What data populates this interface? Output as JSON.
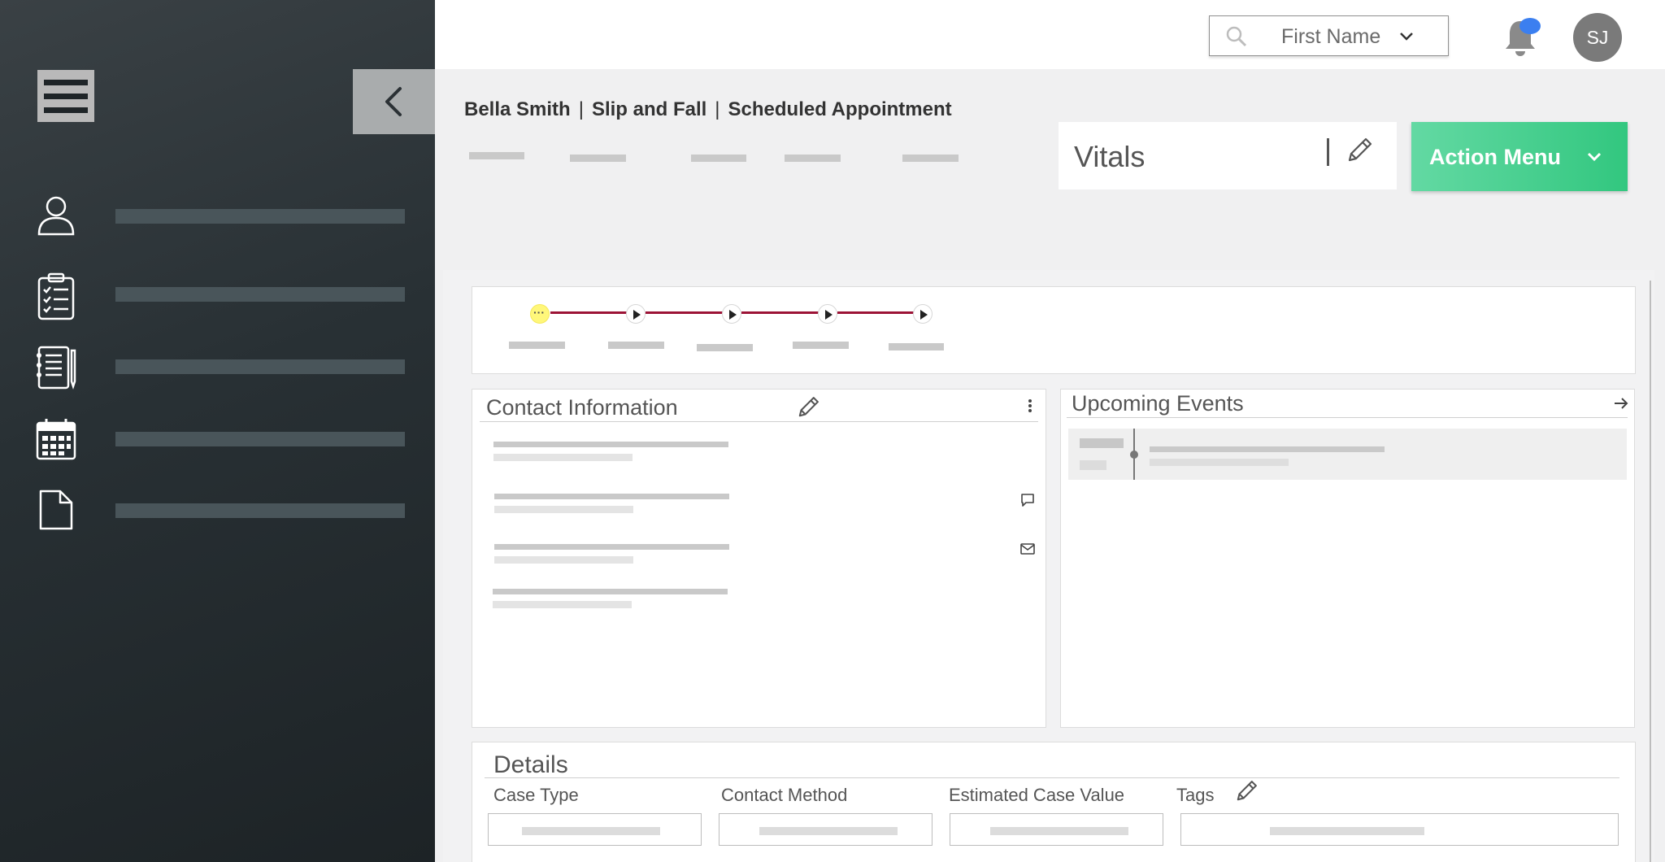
{
  "topbar": {
    "search": {
      "selected": "First Name"
    },
    "avatar_initials": "SJ"
  },
  "sidebar": {
    "items": [
      {
        "icon": "person-icon"
      },
      {
        "icon": "clipboard-checklist-icon"
      },
      {
        "icon": "notepad-icon"
      },
      {
        "icon": "calendar-icon"
      },
      {
        "icon": "document-icon"
      }
    ]
  },
  "header": {
    "breadcrumb": [
      "Bella Smith",
      "Slip and Fall",
      "Scheduled Appointment"
    ],
    "separator": "|",
    "vitals_label": "Vitals",
    "action_menu_label": "Action Menu"
  },
  "progress": {
    "active_step_glyph": "···",
    "step_count": 5,
    "line_color": "#9c1336",
    "active_color": "#fff77a"
  },
  "contact": {
    "title": "Contact Information"
  },
  "events": {
    "title": "Upcoming Events"
  },
  "details": {
    "title": "Details",
    "fields": [
      "Case Type",
      "Contact Method",
      "Estimated Case Value",
      "Tags"
    ]
  },
  "colors": {
    "accent_green": "#32c77f",
    "notification_blue": "#3b7ff0",
    "sidebar_dark": "#283034"
  }
}
